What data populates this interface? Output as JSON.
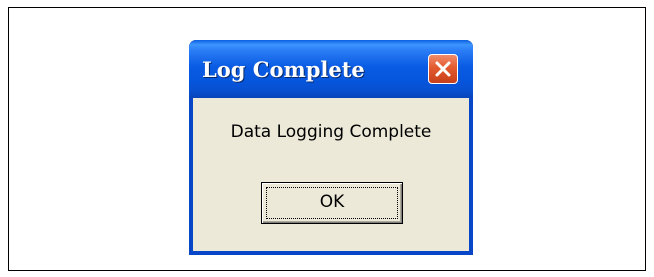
{
  "dialog": {
    "title": "Log Complete",
    "message": "Data Logging Complete",
    "ok_label": "OK",
    "close_icon": "close-icon"
  },
  "colors": {
    "titlebar": "#0a5ce4",
    "close_button": "#e35a2f",
    "dialog_body": "#ece9d8"
  }
}
